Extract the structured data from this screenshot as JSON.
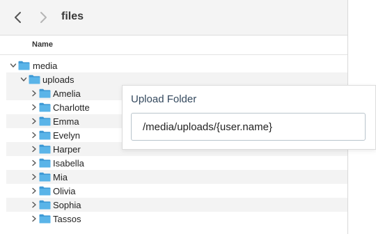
{
  "window": {
    "title": "files"
  },
  "toolbar": {
    "back_icon": "chevron-left-icon",
    "forward_icon": "chevron-right-icon"
  },
  "columns": {
    "name": "Name"
  },
  "tree": {
    "root": "media",
    "child": "uploads",
    "items": [
      "Amelia",
      "Charlotte",
      "Emma",
      "Evelyn",
      "Harper",
      "Isabella",
      "Mia",
      "Olivia",
      "Sophia",
      "Tassos"
    ]
  },
  "upload_panel": {
    "title": "Upload Folder",
    "value": "/media/uploads/{user.name}"
  },
  "colors": {
    "folder": "#5ab4e8",
    "folder_tab": "#3e9ad6",
    "panel_title": "#34495e"
  }
}
